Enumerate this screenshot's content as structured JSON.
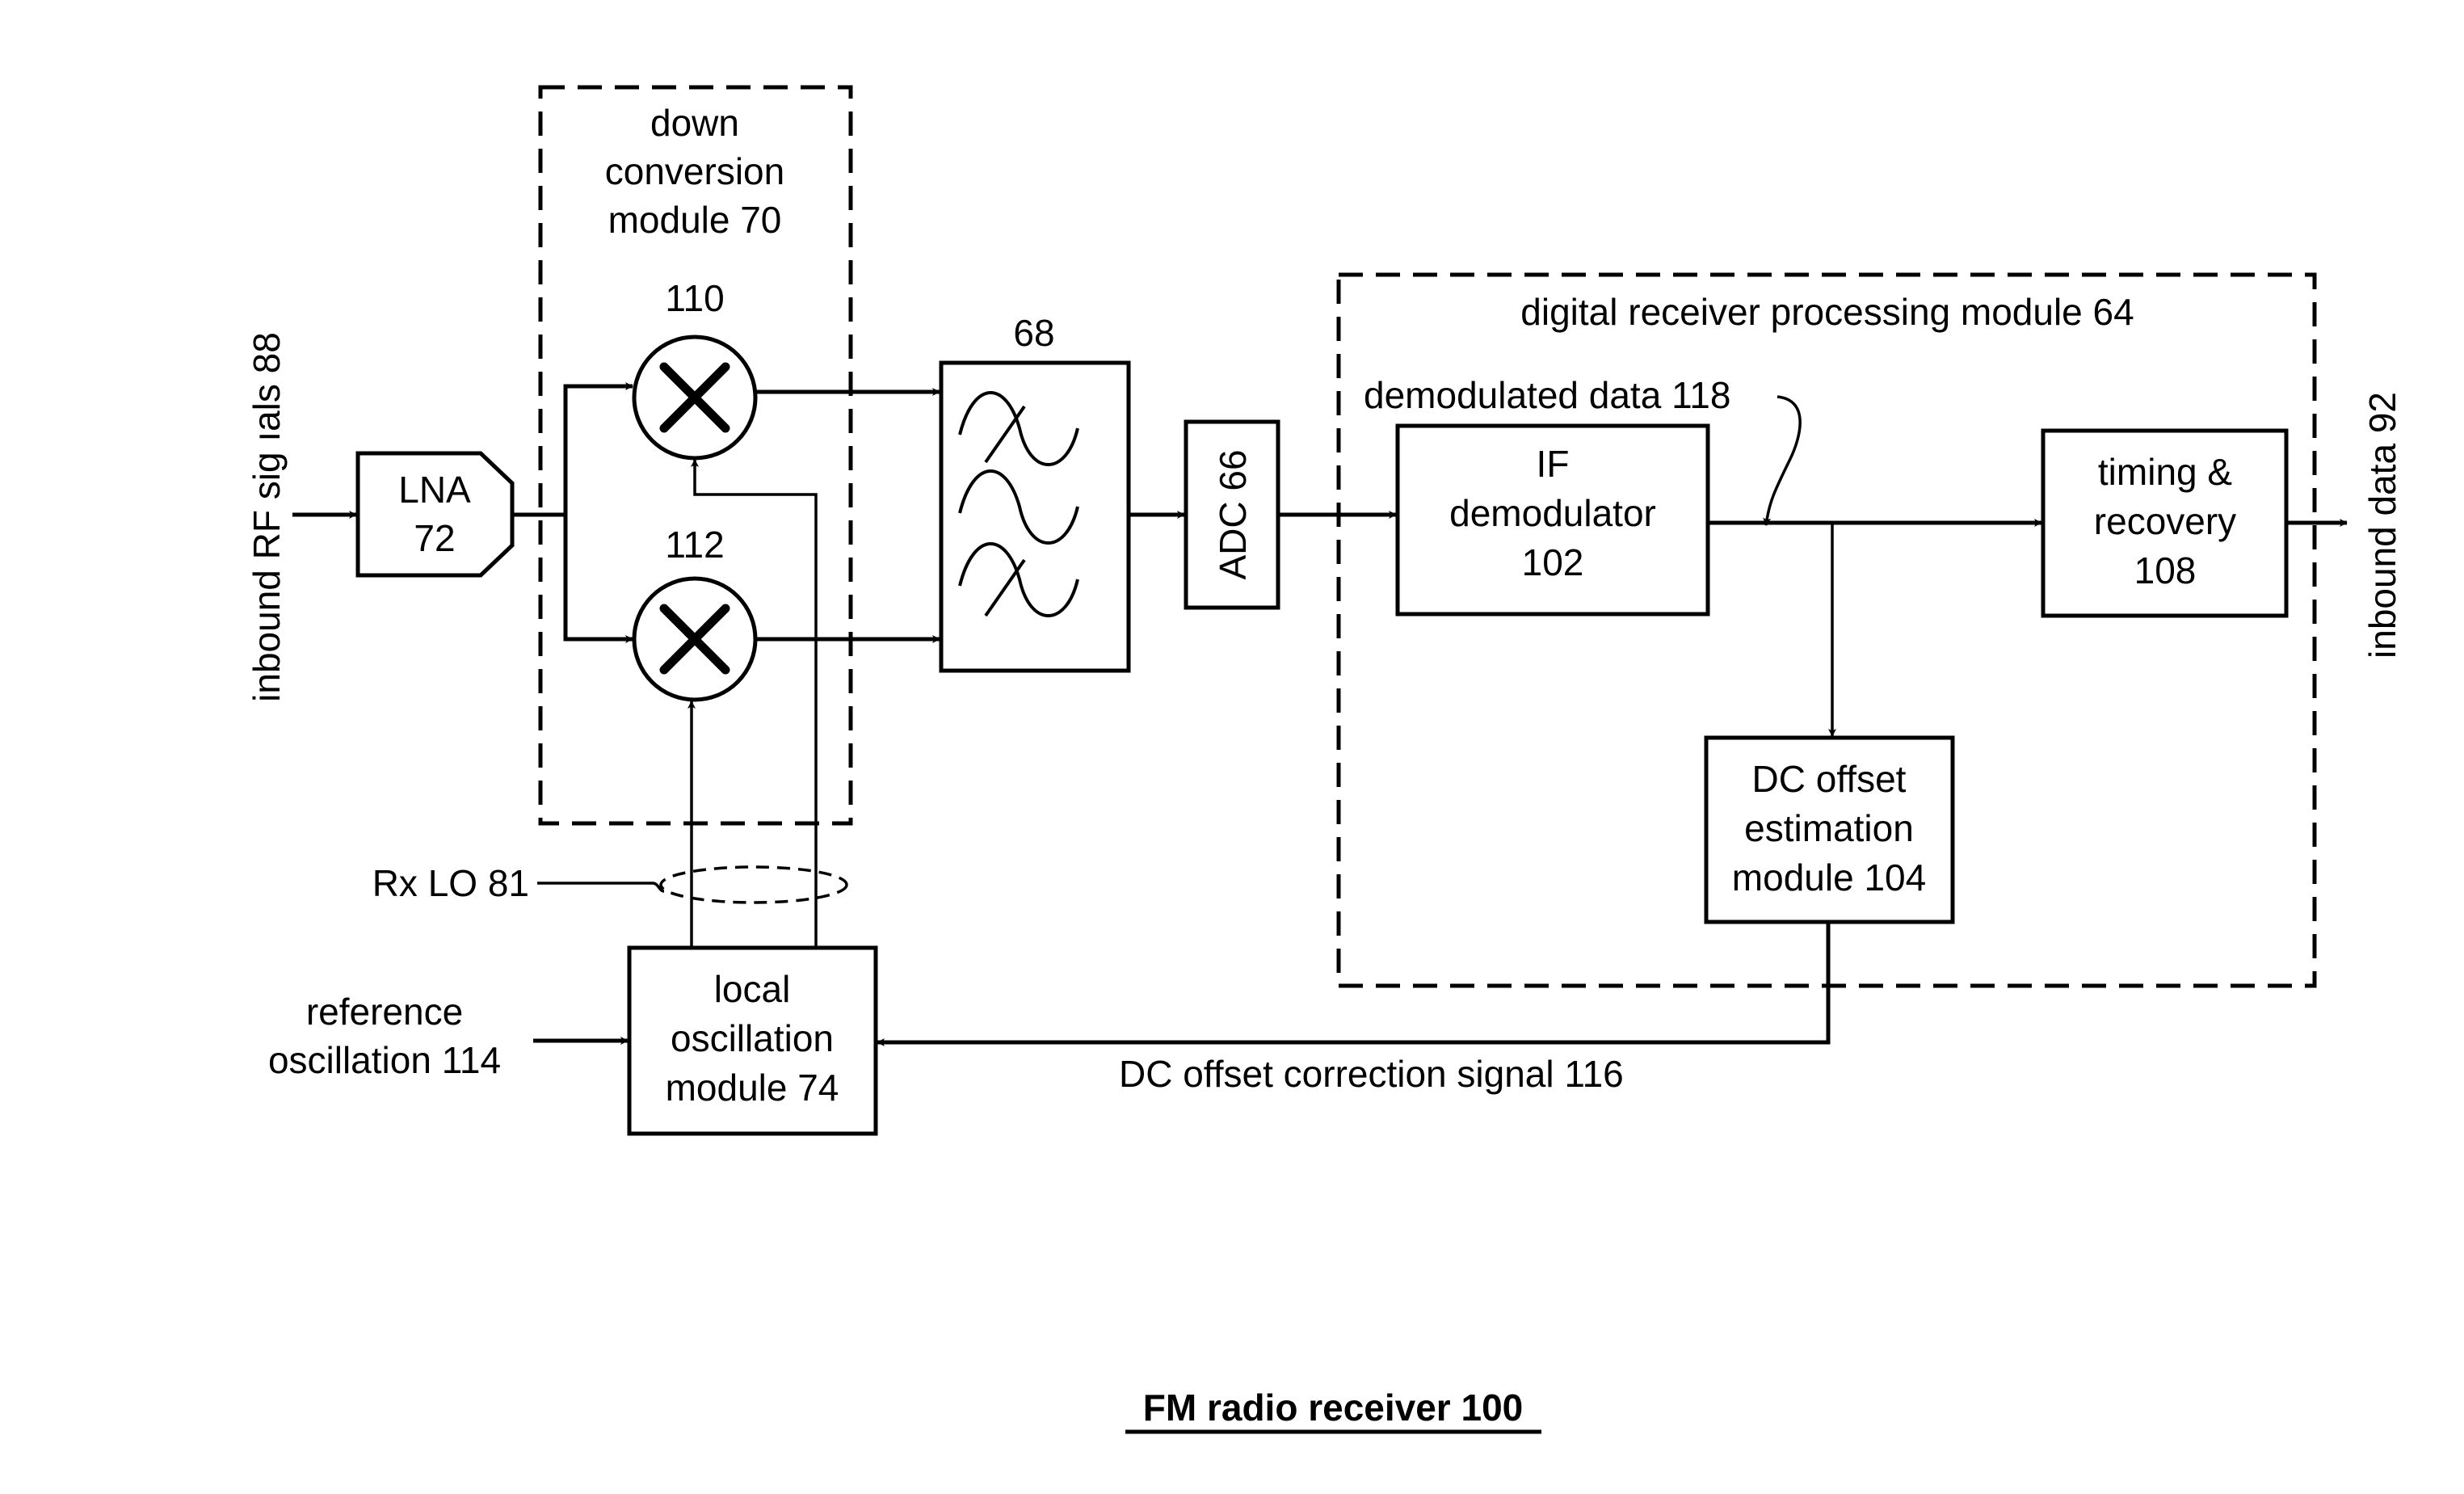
{
  "figure": {
    "caption": "FM radio receiver 100"
  },
  "inputs": {
    "inbound_rf": "inbound RF sig ıals 88",
    "reference": [
      "reference",
      "oscillation 114"
    ]
  },
  "outputs": {
    "inbound_data": "inbound data 92"
  },
  "blocks": {
    "down_conversion": {
      "lines": [
        "down",
        "conversion",
        "module 70"
      ]
    },
    "lna": {
      "lines": [
        "LNA",
        "72"
      ]
    },
    "mixer_i": {
      "ref": "110",
      "symbol": "multiply-icon"
    },
    "mixer_q": {
      "ref": "112",
      "symbol": "multiply-icon"
    },
    "filter": {
      "ref": "68",
      "symbol": "bandpass-filter-icon"
    },
    "adc": {
      "label": "ADC  66"
    },
    "digital_rx": {
      "label": "digital receiver processing module 64"
    },
    "if_demod": {
      "lines": [
        "IF",
        "demodulator",
        "102"
      ]
    },
    "timing": {
      "lines": [
        "timing &",
        "recovery",
        "108"
      ]
    },
    "dc_offset": {
      "lines": [
        "DC offset",
        "estimation",
        "module 104"
      ]
    },
    "local_osc": {
      "lines": [
        "local",
        "oscillation",
        "module 74"
      ]
    }
  },
  "signals": {
    "demod_data": "demodulated data 118",
    "rx_lo": "Rx LO 81",
    "dc_correction": "DC offset correction signal 116"
  }
}
